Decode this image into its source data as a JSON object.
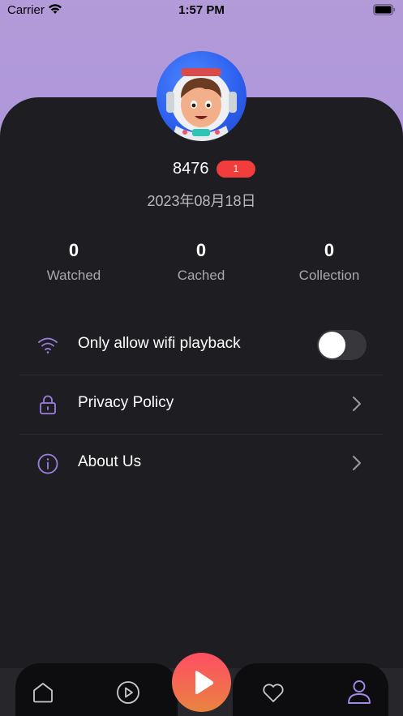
{
  "status_bar": {
    "carrier": "Carrier",
    "time": "1:57 PM"
  },
  "profile": {
    "username": "8476",
    "badge": "1",
    "date": "2023年08月18日",
    "avatar": "astronaut-avatar"
  },
  "stats": [
    {
      "value": "0",
      "label": "Watched"
    },
    {
      "value": "0",
      "label": "Cached"
    },
    {
      "value": "0",
      "label": "Collection"
    }
  ],
  "settings": {
    "wifi": {
      "label": "Only allow wifi playback",
      "icon": "wifi-icon",
      "enabled": false
    },
    "privacy": {
      "label": "Privacy Policy",
      "icon": "lock-icon"
    },
    "about": {
      "label": "About Us",
      "icon": "info-icon"
    }
  },
  "tabbar": {
    "tabs": [
      "home-icon",
      "play-circle-icon",
      "play-icon",
      "heart-icon",
      "user-icon"
    ],
    "active": "user-icon"
  },
  "colors": {
    "accent": "#9b7fe0",
    "badge": "#f23d3d",
    "card_bg": "#1e1e22",
    "play_gradient_top": "#ff4e63",
    "play_gradient_bottom": "#e9843f"
  }
}
